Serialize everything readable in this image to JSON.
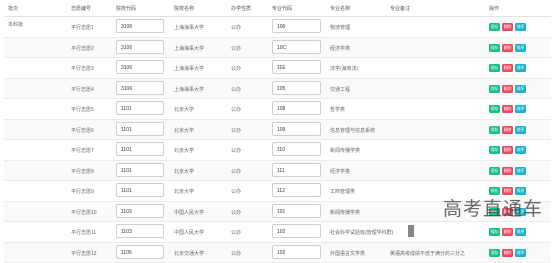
{
  "headers": {
    "batch": "批次",
    "volunteer_no": "志愿编号",
    "school_code": "院校代码",
    "school_name": "院校名称",
    "school_type": "办学性质",
    "major_code": "专业代码",
    "major_name": "专业名称",
    "major_note": "专业备注",
    "actions": "操作"
  },
  "batch_value": "本科批",
  "buttons": {
    "save": "保存",
    "delete": "删除",
    "sort": "排序"
  },
  "rows": [
    {
      "vol": "平行志愿1",
      "school_code": "3106",
      "school_name": "上海海事大学",
      "type": "公办",
      "major_code": "106",
      "major_name": "物流管理"
    },
    {
      "vol": "平行志愿2",
      "school_code": "3106",
      "school_name": "上海海事大学",
      "type": "公办",
      "major_code": "10C",
      "major_name": "经济学类"
    },
    {
      "vol": "平行志愿3",
      "school_code": "3106",
      "school_name": "上海海事大学",
      "type": "公办",
      "major_code": "11E",
      "major_name": "法学(海商法)"
    },
    {
      "vol": "平行志愿4",
      "school_code": "3106",
      "school_name": "上海海事大学",
      "type": "公办",
      "major_code": "105",
      "major_name": "交通工程"
    },
    {
      "vol": "平行志愿5",
      "school_code": "1101",
      "school_name": "北京大学",
      "type": "公办",
      "major_code": "108",
      "major_name": "哲学类"
    },
    {
      "vol": "平行志愿6",
      "school_code": "1101",
      "school_name": "北京大学",
      "type": "公办",
      "major_code": "109",
      "major_name": "信息管理与信息系统"
    },
    {
      "vol": "平行志愿7",
      "school_code": "1101",
      "school_name": "北京大学",
      "type": "公办",
      "major_code": "110",
      "major_name": "新闻传播学类"
    },
    {
      "vol": "平行志愿8",
      "school_code": "1101",
      "school_name": "北京大学",
      "type": "公办",
      "major_code": "111",
      "major_name": "经济学类"
    },
    {
      "vol": "平行志愿9",
      "school_code": "1101",
      "school_name": "北京大学",
      "type": "公办",
      "major_code": "112",
      "major_name": "工商管理类"
    },
    {
      "vol": "平行志愿10",
      "school_code": "1103",
      "school_name": "中国人民大学",
      "type": "公办",
      "major_code": "101",
      "major_name": "新闻传播学类"
    },
    {
      "vol": "平行志愿11",
      "school_code": "1103",
      "school_name": "中国人民大学",
      "type": "公办",
      "major_code": "102",
      "major_name": "社会科学试验班(管理学科群)"
    },
    {
      "vol": "平行志愿12",
      "school_code": "1105",
      "school_name": "北京交通大学",
      "type": "公办",
      "major_code": "102",
      "major_name": "外国语言文学类",
      "note": "英语高考成绩不低于满分的三分之"
    }
  ],
  "watermark": "高考直通车"
}
